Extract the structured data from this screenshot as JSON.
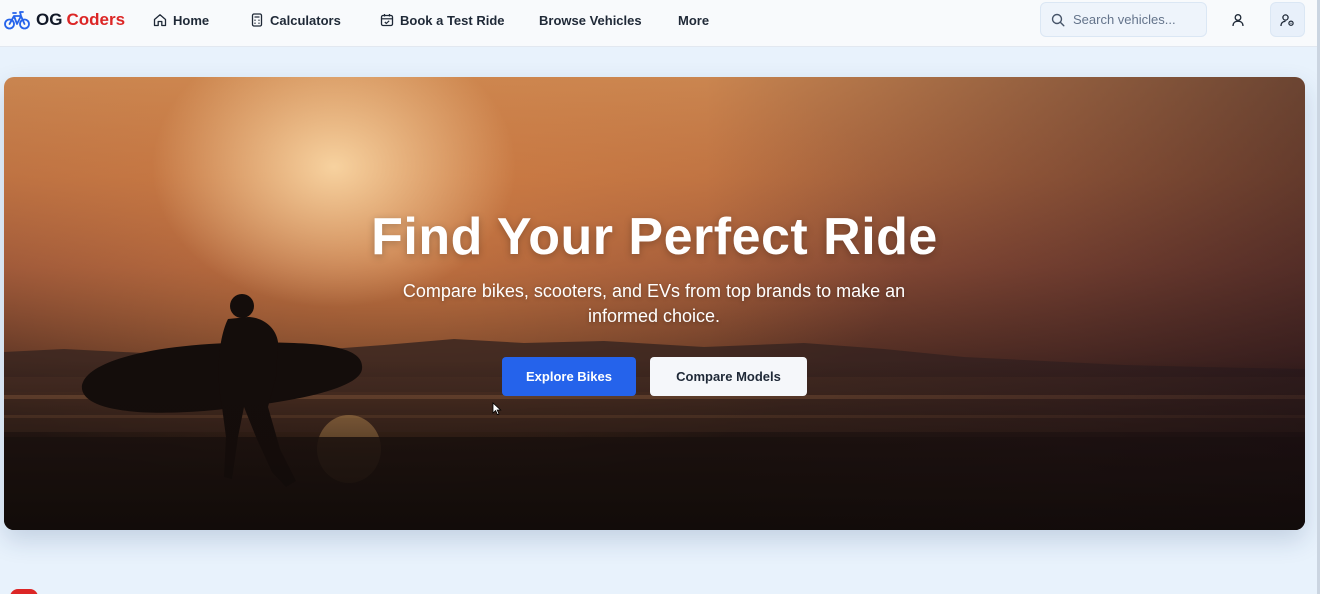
{
  "brand": {
    "part1": "OG",
    "part2": "Coders",
    "icon": "bicycle-icon",
    "accent": "#dc2626"
  },
  "nav": {
    "home": {
      "label": "Home",
      "icon": "home-icon"
    },
    "calculators": {
      "label": "Calculators",
      "icon": "calculator-icon"
    },
    "test_ride": {
      "label": "Book a Test Ride",
      "icon": "calendar-icon"
    },
    "browse": {
      "label": "Browse Vehicles"
    },
    "more": {
      "label": "More"
    }
  },
  "search": {
    "placeholder": "Search vehicles...",
    "value": "",
    "icon": "search-icon"
  },
  "account": {
    "user_icon": "user-icon",
    "settings_icon": "user-settings-icon"
  },
  "hero": {
    "title": "Find Your Perfect Ride",
    "subtitle": "Compare bikes, scooters, and EVs from top brands to make an informed choice.",
    "primary_button": "Explore Bikes",
    "secondary_button": "Compare Models",
    "primary_color": "#2563eb"
  }
}
